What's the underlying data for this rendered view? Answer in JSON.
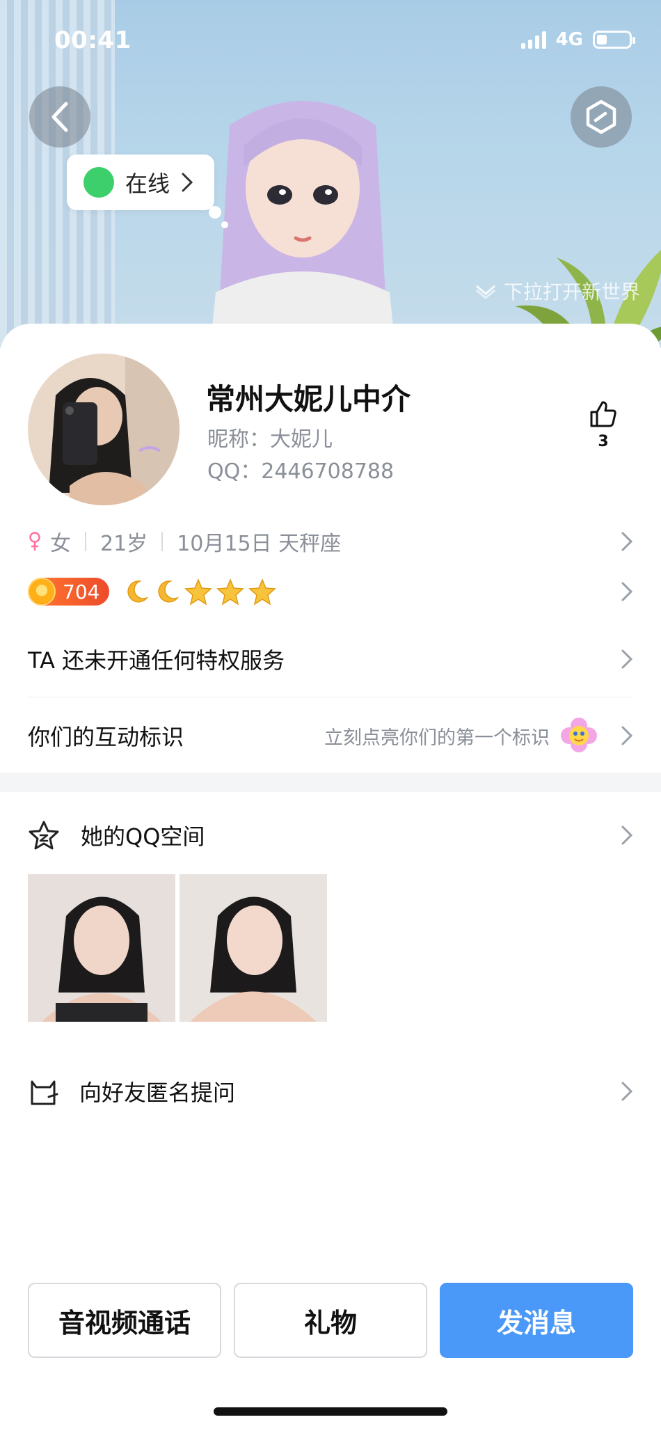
{
  "status_bar": {
    "time": "00:41",
    "network": "4G"
  },
  "hero": {
    "online_label": "在线",
    "pull_hint": "下拉打开新世界"
  },
  "profile": {
    "name": "常州大妮儿中介",
    "nickname": "昵称：大妮儿",
    "qq": "QQ：2446708788",
    "likes": "3",
    "gender": "女",
    "age": "21岁",
    "birthday": "10月15日 天秤座",
    "level": "704",
    "level_icons": [
      "moon-icon",
      "moon-icon",
      "star-icon",
      "star-icon",
      "star-icon"
    ]
  },
  "menu": {
    "privilege": "TA 还未开通任何特权服务",
    "interaction": "你们的互动标识",
    "interaction_hint": "立刻点亮你们的第一个标识",
    "qzone": "她的QQ空间",
    "anonymous_ask": "向好友匿名提问"
  },
  "actions": {
    "call": "音视频通话",
    "gift": "礼物",
    "message": "发消息"
  },
  "colors": {
    "primary": "#4a98f7",
    "online": "#3ccf6b",
    "level_badge": "#ee4b2b",
    "female": "#ff6fa3"
  }
}
